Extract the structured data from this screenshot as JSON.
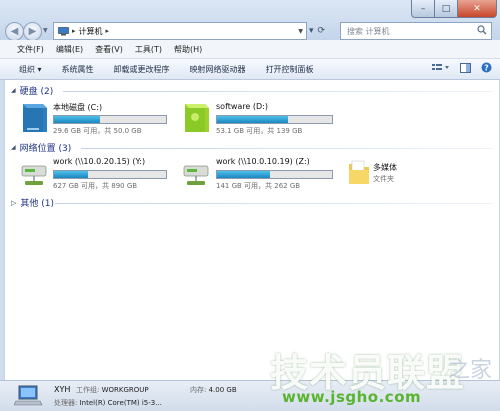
{
  "window": {
    "controls": {
      "minimize": "–",
      "maximize": "□",
      "close": "✕"
    }
  },
  "address": {
    "crumb": "计算机",
    "search_placeholder": "搜索 计算机"
  },
  "menu": [
    "文件(F)",
    "编辑(E)",
    "查看(V)",
    "工具(T)",
    "帮助(H)"
  ],
  "commands": [
    "组织 ▾",
    "系统属性",
    "卸载或更改程序",
    "映射网络驱动器",
    "打开控制面板"
  ],
  "groups": {
    "hdd": {
      "label": "硬盘 (2)"
    },
    "net": {
      "label": "网络位置 (3)"
    },
    "other": {
      "label": "其他 (1)"
    }
  },
  "drives": [
    {
      "name": "本地磁盘 (C:)",
      "info": "29.6 GB 可用，共 50.0 GB",
      "used_fraction": 0.41,
      "icon": "hard-drive-icon",
      "color": "#2d7fbf"
    },
    {
      "name": "software (D:)",
      "info": "53.1 GB 可用，共 139 GB",
      "used_fraction": 0.62,
      "icon": "hard-drive-icon",
      "color": "#8ac926"
    }
  ],
  "network": [
    {
      "name": "work (\\\\10.0.20.15) (Y:)",
      "info": "627 GB 可用，共 890 GB",
      "used_fraction": 0.3,
      "icon": "network-drive-icon"
    },
    {
      "name": "work (\\\\10.0.10.19) (Z:)",
      "info": "141 GB 可用，共 262 GB",
      "used_fraction": 0.46,
      "icon": "network-drive-icon"
    },
    {
      "name": "多媒体",
      "info": "文件夹",
      "icon": "folder-icon"
    }
  ],
  "details": {
    "pc_name": "XYH",
    "workgroup_label": "工作组:",
    "workgroup": "WORKGROUP",
    "memory_label": "内存:",
    "memory": "4.00 GB",
    "cpu_label": "处理器:",
    "cpu": "Intel(R) Core(TM) i5-3..."
  },
  "watermark": {
    "text": "技术员联盟",
    "url": "www.jsgho.com",
    "faint": "之家"
  }
}
